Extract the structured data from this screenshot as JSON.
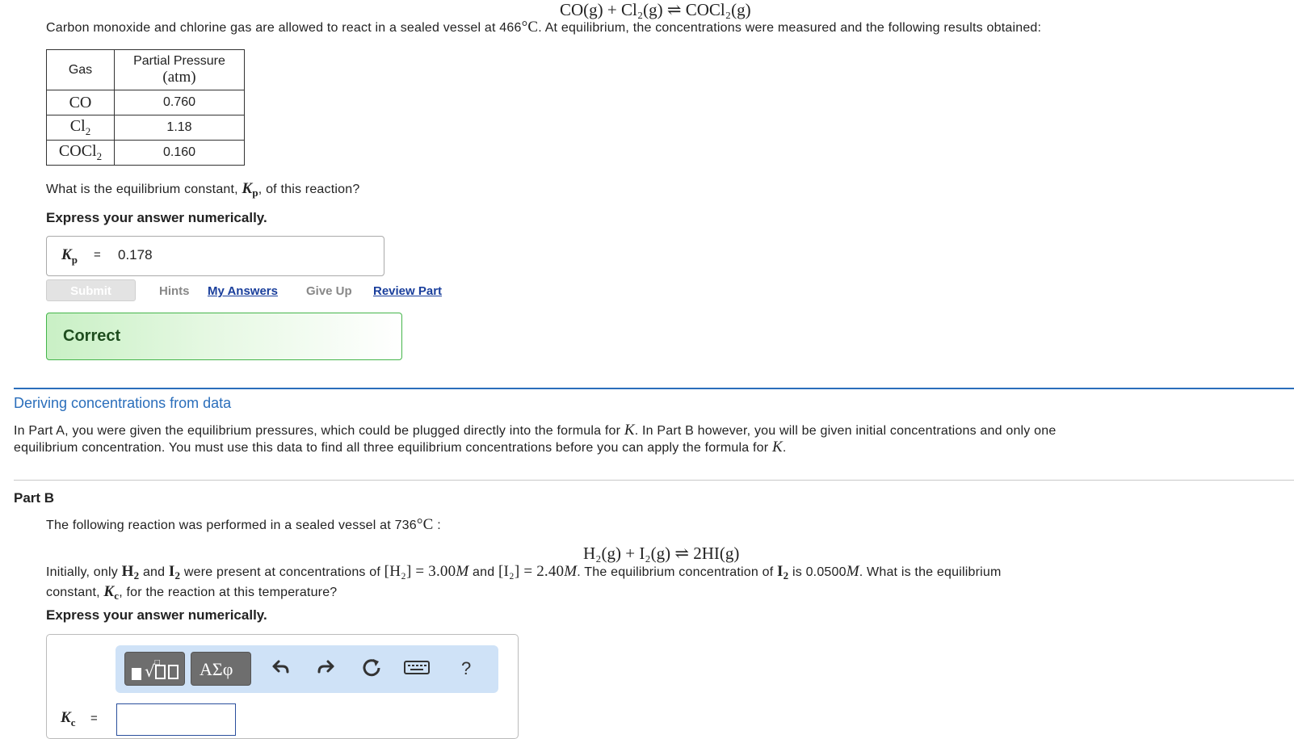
{
  "header_equation": "CO(g) + Cl₂(g) ⇌ COCl₂(g)",
  "intro": {
    "text_before": "Carbon monoxide and chlorine gas are allowed to react in a sealed vessel at 466",
    "temp_unit": "°C",
    "text_after": ". At equilibrium, the concentrations were measured and the following results obtained:"
  },
  "table": {
    "header_gas": "Gas",
    "header_pressure_line1": "Partial Pressure",
    "header_pressure_line2": "(atm)",
    "rows": [
      {
        "gas": "CO",
        "gas_sub": "",
        "gas_tail": "",
        "value": "0.760"
      },
      {
        "gas": "Cl",
        "gas_sub": "2",
        "gas_tail": "",
        "value": "1.18"
      },
      {
        "gas": "COCl",
        "gas_sub": "2",
        "gas_tail": "",
        "value": "0.160"
      }
    ]
  },
  "partA": {
    "question_before": "What is the equilibrium constant, ",
    "question_symbol": "K",
    "question_sub": "p",
    "question_after": ", of this reaction?",
    "instruction": "Express your answer numerically.",
    "answer_label": "K",
    "answer_label_sub": "p",
    "answer_equals": "=",
    "answer_value": "0.178",
    "submit_label": "Submit",
    "hints_label": "Hints",
    "my_answers_label": "My Answers",
    "give_up_label": "Give Up",
    "review_part_label": "Review Part",
    "feedback": "Correct"
  },
  "section": {
    "title": "Deriving concentrations from data",
    "para_line1_a": "In Part A, you were given the equilibrium pressures, which could be plugged directly into the formula for ",
    "para_K": "K",
    "para_line1_b": ". In Part B however, you will be given initial concentrations and only one",
    "para_line2_a": "equilibrium concentration. You must use this data to find all three equilibrium concentrations before you can apply the formula for ",
    "para_line2_b": "."
  },
  "partB": {
    "title": "Part B",
    "intro_before": "The following reaction was performed in a sealed vessel at 736",
    "intro_unit": "°C",
    "intro_after": " :",
    "equation": "H₂(g) + I₂(g) ⇌ 2HI(g)",
    "line1_a": "Initially, only ",
    "H2": "H",
    "line1_and": " and ",
    "I2": "I",
    "line1_b": " were present at concentrations of ",
    "conc_H2": "[H₂] = 3.00",
    "M": "M",
    "line1_and2": " and ",
    "conc_I2": "[I₂] = 2.40",
    "line1_c": ". The equilibrium concentration of ",
    "line1_d": " is 0.0500",
    "line1_e": ". What is the equilibrium",
    "line2_a": "constant, ",
    "Kc": "K",
    "Kc_sub": "c",
    "line2_b": ", for the reaction at this temperature?",
    "instruction": "Express your answer numerically.",
    "answer_label": "K",
    "answer_label_sub": "c",
    "answer_equals": "=",
    "toolbar": {
      "templates_icon": "templates-icon",
      "greek_label": "ΑΣφ",
      "undo_icon": "undo-icon",
      "redo_icon": "redo-icon",
      "reset_icon": "reset-icon",
      "keyboard_icon": "keyboard-icon",
      "help_label": "?"
    }
  },
  "colors": {
    "link_blue": "#1a3f9c",
    "section_title": "#2a6ebb",
    "correct_border": "#44b54a",
    "correct_bg": "#c9f0c5",
    "toolbar_bg": "#cfe2f7"
  }
}
